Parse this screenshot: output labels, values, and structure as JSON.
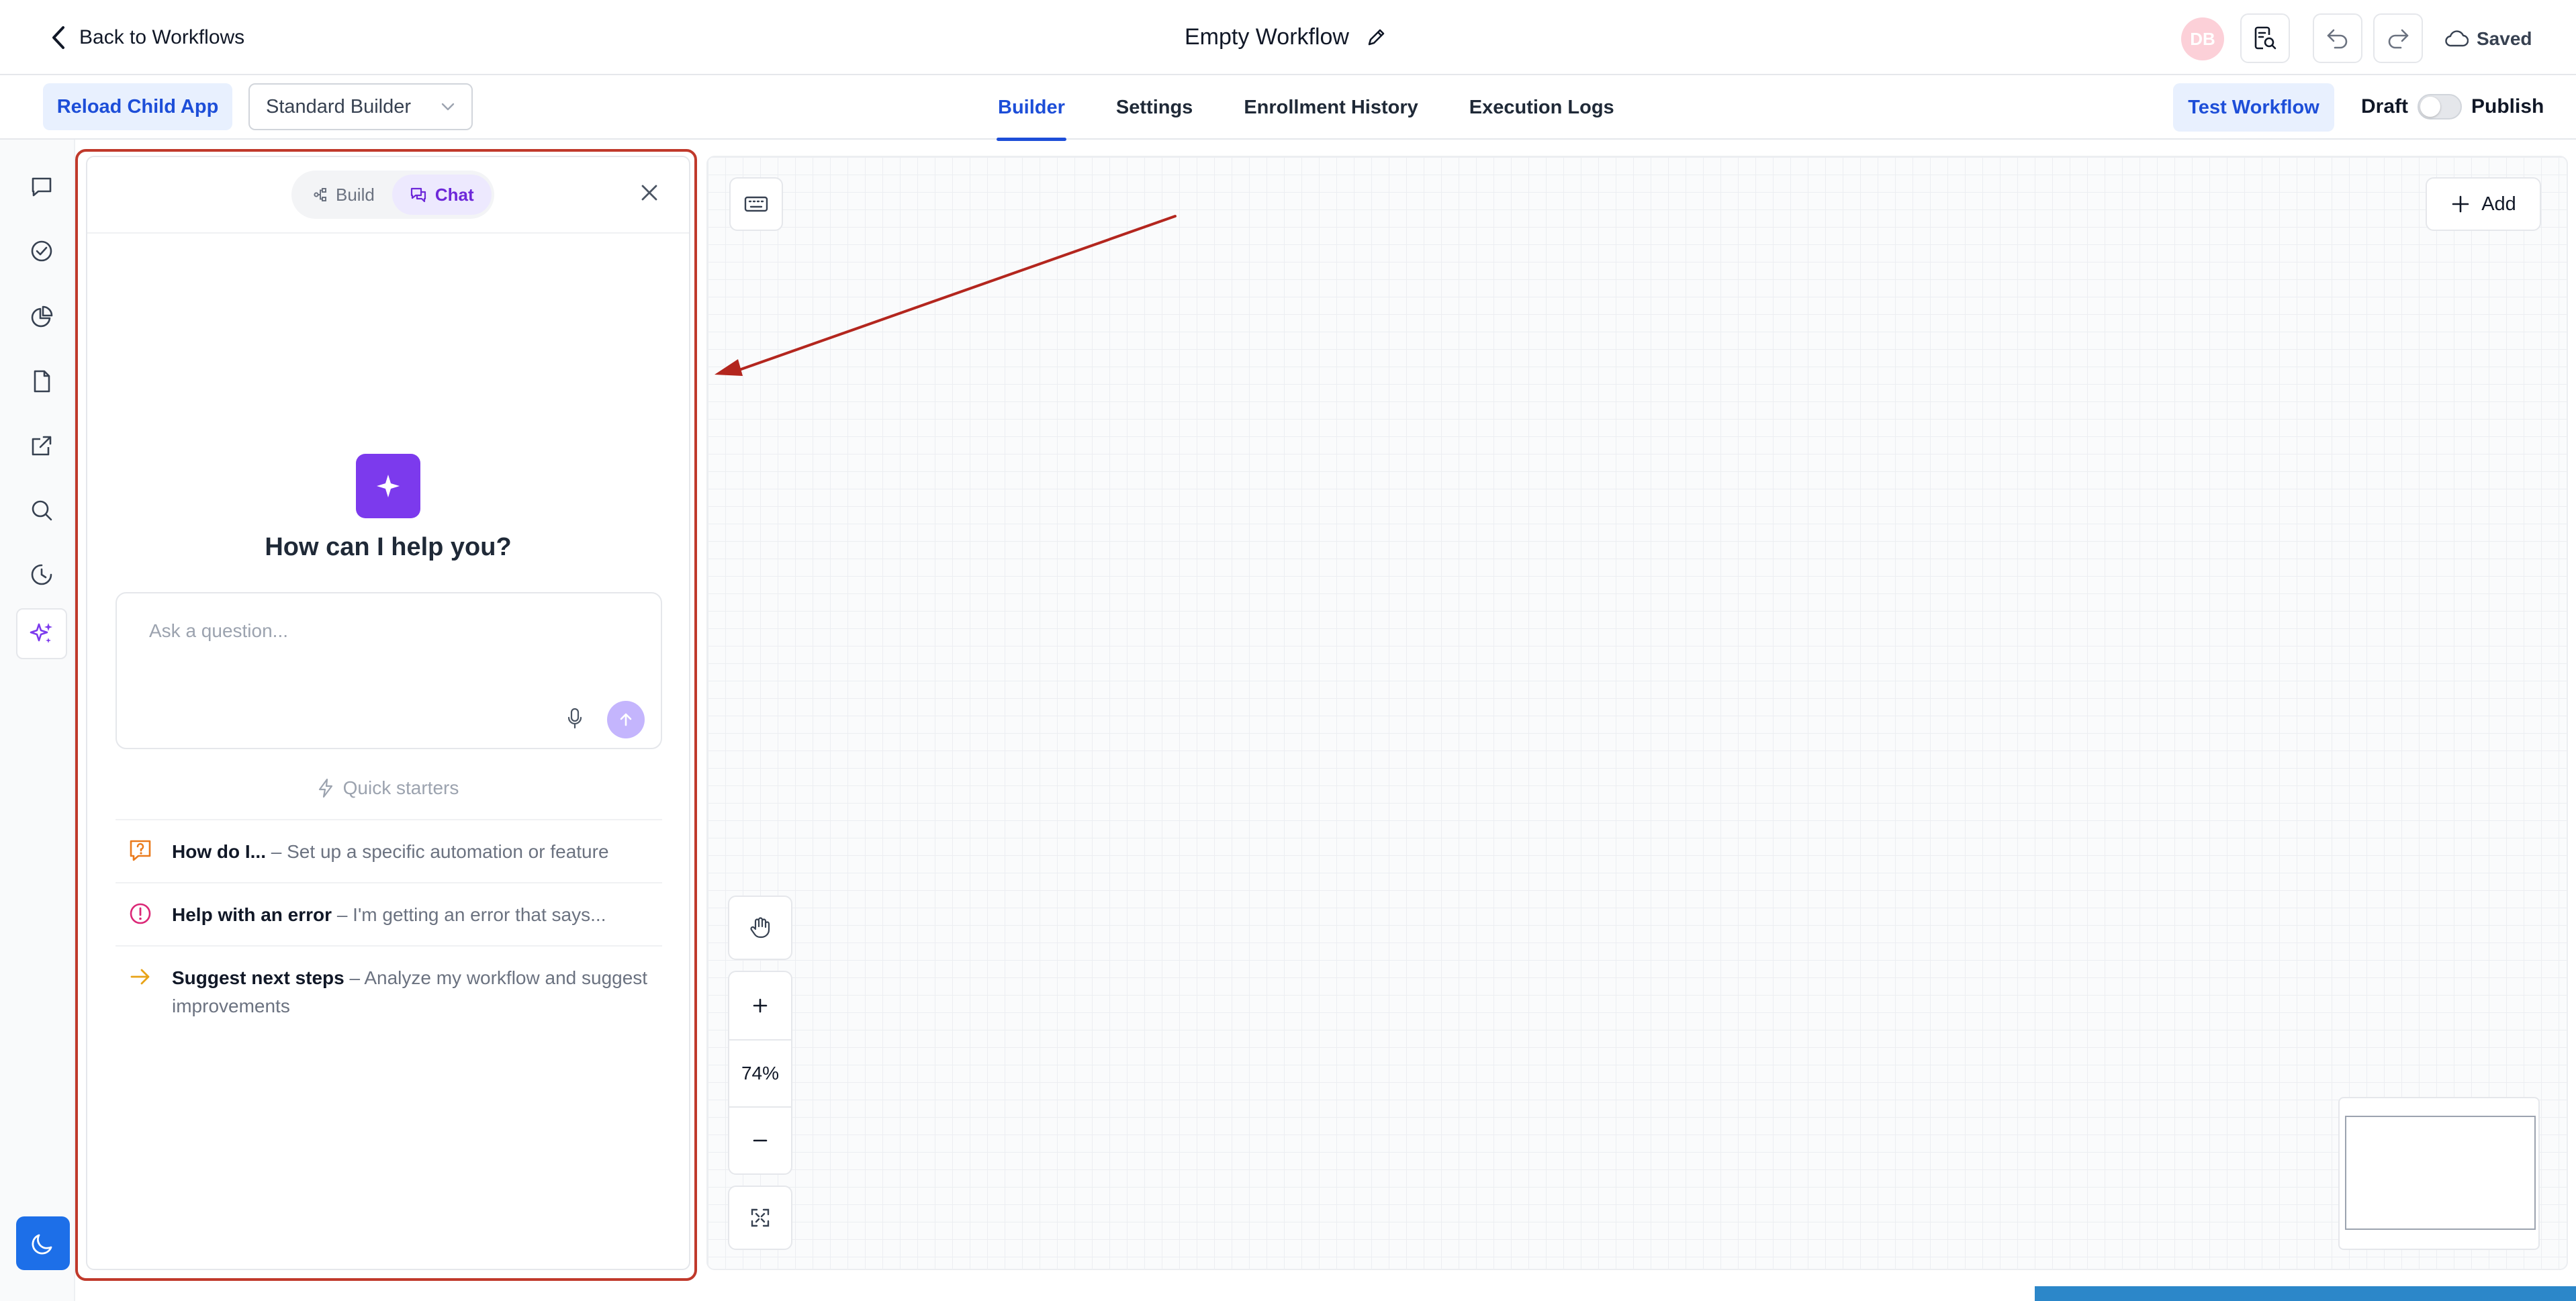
{
  "header": {
    "back_label": "Back to Workflows",
    "workflow_title": "Empty Workflow",
    "avatar_initials": "DB",
    "saved_label": "Saved"
  },
  "toolbar": {
    "reload_label": "Reload Child App",
    "builder_select": "Standard Builder",
    "tabs": [
      {
        "label": "Builder",
        "active": true
      },
      {
        "label": "Settings",
        "active": false
      },
      {
        "label": "Enrollment History",
        "active": false
      },
      {
        "label": "Execution Logs",
        "active": false
      }
    ],
    "test_label": "Test Workflow",
    "draft_label": "Draft",
    "publish_label": "Publish",
    "published": false
  },
  "rail": {
    "icons": [
      "chat-icon",
      "check-circle-icon",
      "pie-chart-icon",
      "document-icon",
      "external-link-icon",
      "search-icon",
      "history-icon",
      "ai-sparkle-icon"
    ],
    "active": "ai-sparkle-icon",
    "bottom": "moon-icon"
  },
  "assistant": {
    "mode_build": "Build",
    "mode_chat": "Chat",
    "active_mode": "Chat",
    "heading": "How can I help you?",
    "input_placeholder": "Ask a question...",
    "input_value": "",
    "quick_starters_label": "Quick starters",
    "quick_starters": [
      {
        "title": "How do I...",
        "desc": " – Set up a specific automation or feature",
        "icon": "question-bubble-icon",
        "color": "#ea7a1c"
      },
      {
        "title": "Help with an error",
        "desc": " – I'm getting an error that says...",
        "icon": "alert-circle-icon",
        "color": "#db2777"
      },
      {
        "title": "Suggest next steps",
        "desc": " – Analyze my workflow and suggest improvements",
        "icon": "arrow-right-icon",
        "color": "#e8a317"
      }
    ],
    "accent_color": "#7c3aed"
  },
  "canvas": {
    "add_label": "Add",
    "zoom_level": "74%"
  },
  "colors": {
    "primary": "#1d4ed8",
    "annotation": "#b3261e"
  }
}
